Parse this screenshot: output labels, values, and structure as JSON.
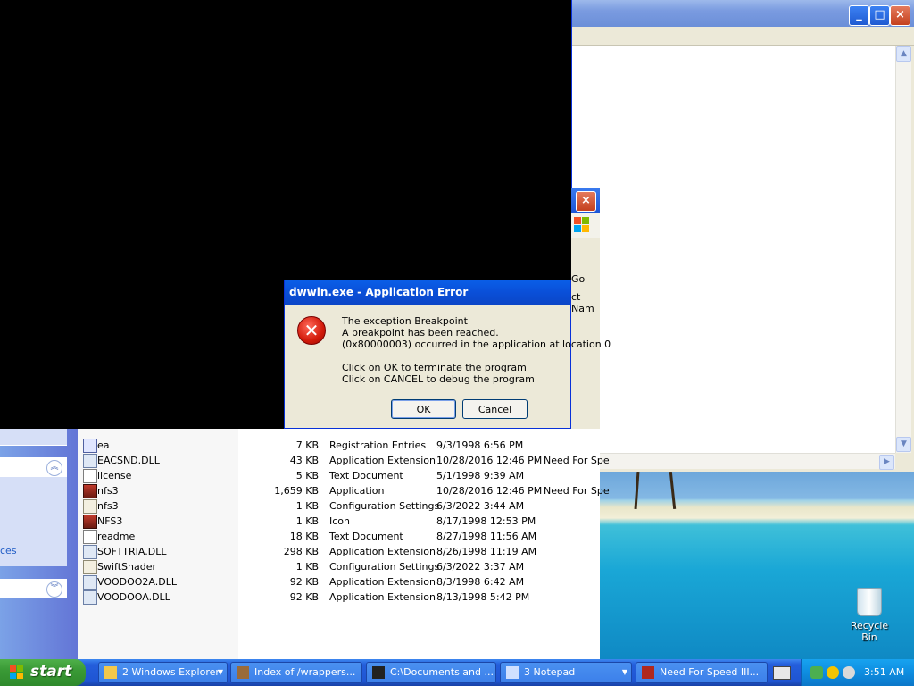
{
  "dialog": {
    "title": "dwwin.exe - Application Error",
    "lines": [
      "The exception Breakpoint",
      "A breakpoint has been reached.",
      " (0x80000003) occurred in the application at location 0",
      "Click on OK to terminate the program",
      "Click on CANCEL to debug the program"
    ],
    "ok_label": "OK",
    "cancel_label": "Cancel"
  },
  "explorer": {
    "go_label": "Go",
    "column_fragment": "ct Nam",
    "left_pane_link_fragment": "ces",
    "files": [
      {
        "name": "ea",
        "size": "7 KB",
        "type": "Registration Entries",
        "date": "9/3/1998 6:56 PM",
        "comment": "",
        "icon": "reg"
      },
      {
        "name": "EACSND.DLL",
        "size": "43 KB",
        "type": "Application Extension",
        "date": "10/28/2016 12:46 PM",
        "comment": "Need For Spe",
        "icon": "dll"
      },
      {
        "name": "license",
        "size": "5 KB",
        "type": "Text Document",
        "date": "5/1/1998 9:39 AM",
        "comment": "",
        "icon": "doc"
      },
      {
        "name": "nfs3",
        "size": "1,659 KB",
        "type": "Application",
        "date": "10/28/2016 12:46 PM",
        "comment": "Need For Spe",
        "icon": "exe"
      },
      {
        "name": "nfs3",
        "size": "1 KB",
        "type": "Configuration Settings",
        "date": "6/3/2022 3:44 AM",
        "comment": "",
        "icon": "cfg"
      },
      {
        "name": "NFS3",
        "size": "1 KB",
        "type": "Icon",
        "date": "8/17/1998 12:53 PM",
        "comment": "",
        "icon": "exe"
      },
      {
        "name": "readme",
        "size": "18 KB",
        "type": "Text Document",
        "date": "8/27/1998 11:56 AM",
        "comment": "",
        "icon": "doc"
      },
      {
        "name": "SOFTTRIA.DLL",
        "size": "298 KB",
        "type": "Application Extension",
        "date": "8/26/1998 11:19 AM",
        "comment": "",
        "icon": "dll"
      },
      {
        "name": "SwiftShader",
        "size": "1 KB",
        "type": "Configuration Settings",
        "date": "6/3/2022 3:37 AM",
        "comment": "",
        "icon": "cfg"
      },
      {
        "name": "VOODOO2A.DLL",
        "size": "92 KB",
        "type": "Application Extension",
        "date": "8/3/1998 6:42 AM",
        "comment": "",
        "icon": "dll"
      },
      {
        "name": "VOODOOA.DLL",
        "size": "92 KB",
        "type": "Application Extension",
        "date": "8/13/1998 5:42 PM",
        "comment": "",
        "icon": "dll"
      }
    ]
  },
  "desktop": {
    "recycle_bin_label": "Recycle Bin"
  },
  "taskbar": {
    "start_label": "start",
    "items": [
      {
        "label": "2 Windows Explorer",
        "icon": "folder-icon",
        "has_arrow": true
      },
      {
        "label": "Index of /wrappers...",
        "icon": "browser-icon",
        "has_arrow": false
      },
      {
        "label": "C:\\Documents and ...",
        "icon": "7zip-icon",
        "has_arrow": false
      },
      {
        "label": "3 Notepad",
        "icon": "notepad-icon",
        "has_arrow": true
      },
      {
        "label": "Need For Speed III...",
        "icon": "nfs-icon",
        "has_arrow": false
      }
    ],
    "clock": "3:51 AM"
  },
  "colors": {
    "xp_blue": "#245edb",
    "start_green": "#3a9a36",
    "error_red": "#d21a0a"
  }
}
